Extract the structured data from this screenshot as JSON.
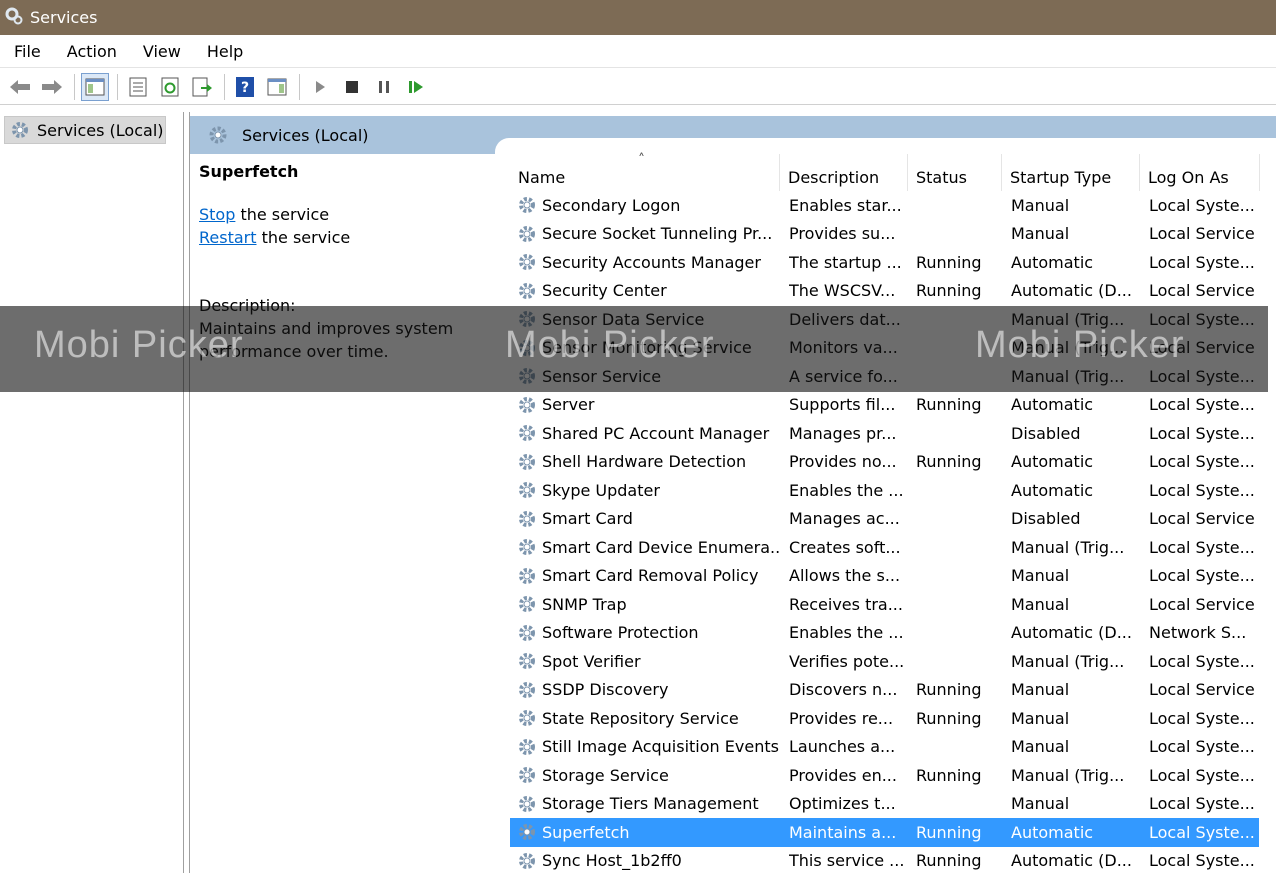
{
  "window": {
    "title": "Services"
  },
  "menu": [
    "File",
    "Action",
    "View",
    "Help"
  ],
  "tree": {
    "root_label": "Services (Local)"
  },
  "pane_header": {
    "label": "Services (Local)"
  },
  "ext": {
    "selected_name": "Superfetch",
    "stop_link": "Stop",
    "stop_rest": " the service",
    "restart_link": "Restart",
    "restart_rest": " the service",
    "desc_label": "Description:",
    "desc_line1": "Maintains and improves system",
    "desc_line2": "performance over time."
  },
  "columns": {
    "name": "Name",
    "description": "Description",
    "status": "Status",
    "startup_type": "Startup Type",
    "log_on_as": "Log On As"
  },
  "rows": [
    {
      "name": "Secondary Logon",
      "description": "Enables star...",
      "status": "",
      "startup": "Manual",
      "logon": "Local Syste..."
    },
    {
      "name": "Secure Socket Tunneling Pr...",
      "description": "Provides su...",
      "status": "",
      "startup": "Manual",
      "logon": "Local Service"
    },
    {
      "name": "Security Accounts Manager",
      "description": "The startup ...",
      "status": "Running",
      "startup": "Automatic",
      "logon": "Local Syste..."
    },
    {
      "name": "Security Center",
      "description": "The WSCSV...",
      "status": "Running",
      "startup": "Automatic (D...",
      "logon": "Local Service"
    },
    {
      "name": "Sensor Data Service",
      "description": "Delivers dat...",
      "status": "",
      "startup": "Manual (Trig...",
      "logon": "Local Syste..."
    },
    {
      "name": "Sensor Monitoring Service",
      "description": "Monitors va...",
      "status": "",
      "startup": "Manual (Trig...",
      "logon": "Local Service"
    },
    {
      "name": "Sensor Service",
      "description": "A service fo...",
      "status": "",
      "startup": "Manual (Trig...",
      "logon": "Local Syste..."
    },
    {
      "name": "Server",
      "description": "Supports fil...",
      "status": "Running",
      "startup": "Automatic",
      "logon": "Local Syste..."
    },
    {
      "name": "Shared PC Account Manager",
      "description": "Manages pr...",
      "status": "",
      "startup": "Disabled",
      "logon": "Local Syste..."
    },
    {
      "name": "Shell Hardware Detection",
      "description": "Provides no...",
      "status": "Running",
      "startup": "Automatic",
      "logon": "Local Syste..."
    },
    {
      "name": "Skype Updater",
      "description": "Enables the ...",
      "status": "",
      "startup": "Automatic",
      "logon": "Local Syste..."
    },
    {
      "name": "Smart Card",
      "description": "Manages ac...",
      "status": "",
      "startup": "Disabled",
      "logon": "Local Service"
    },
    {
      "name": "Smart Card Device Enumera...",
      "description": "Creates soft...",
      "status": "",
      "startup": "Manual (Trig...",
      "logon": "Local Syste..."
    },
    {
      "name": "Smart Card Removal Policy",
      "description": "Allows the s...",
      "status": "",
      "startup": "Manual",
      "logon": "Local Syste..."
    },
    {
      "name": "SNMP Trap",
      "description": "Receives tra...",
      "status": "",
      "startup": "Manual",
      "logon": "Local Service"
    },
    {
      "name": "Software Protection",
      "description": "Enables the ...",
      "status": "",
      "startup": "Automatic (D...",
      "logon": "Network S..."
    },
    {
      "name": "Spot Verifier",
      "description": "Verifies pote...",
      "status": "",
      "startup": "Manual (Trig...",
      "logon": "Local Syste..."
    },
    {
      "name": "SSDP Discovery",
      "description": "Discovers n...",
      "status": "Running",
      "startup": "Manual",
      "logon": "Local Service"
    },
    {
      "name": "State Repository Service",
      "description": "Provides re...",
      "status": "Running",
      "startup": "Manual",
      "logon": "Local Syste..."
    },
    {
      "name": "Still Image Acquisition Events",
      "description": "Launches a...",
      "status": "",
      "startup": "Manual",
      "logon": "Local Syste..."
    },
    {
      "name": "Storage Service",
      "description": "Provides en...",
      "status": "Running",
      "startup": "Manual (Trig...",
      "logon": "Local Syste..."
    },
    {
      "name": "Storage Tiers Management",
      "description": "Optimizes t...",
      "status": "",
      "startup": "Manual",
      "logon": "Local Syste..."
    },
    {
      "name": "Superfetch",
      "description": "Maintains a...",
      "status": "Running",
      "startup": "Automatic",
      "logon": "Local Syste...",
      "selected": true
    },
    {
      "name": "Sync Host_1b2ff0",
      "description": "This service ...",
      "status": "Running",
      "startup": "Automatic (D...",
      "logon": "Local Syste..."
    }
  ],
  "watermark": {
    "text": "Mobi Picker"
  },
  "colors": {
    "titlebar": "#7d6b55",
    "selection": "#3399ff",
    "pane_header": "#a9c3dc",
    "link": "#0066cc"
  }
}
